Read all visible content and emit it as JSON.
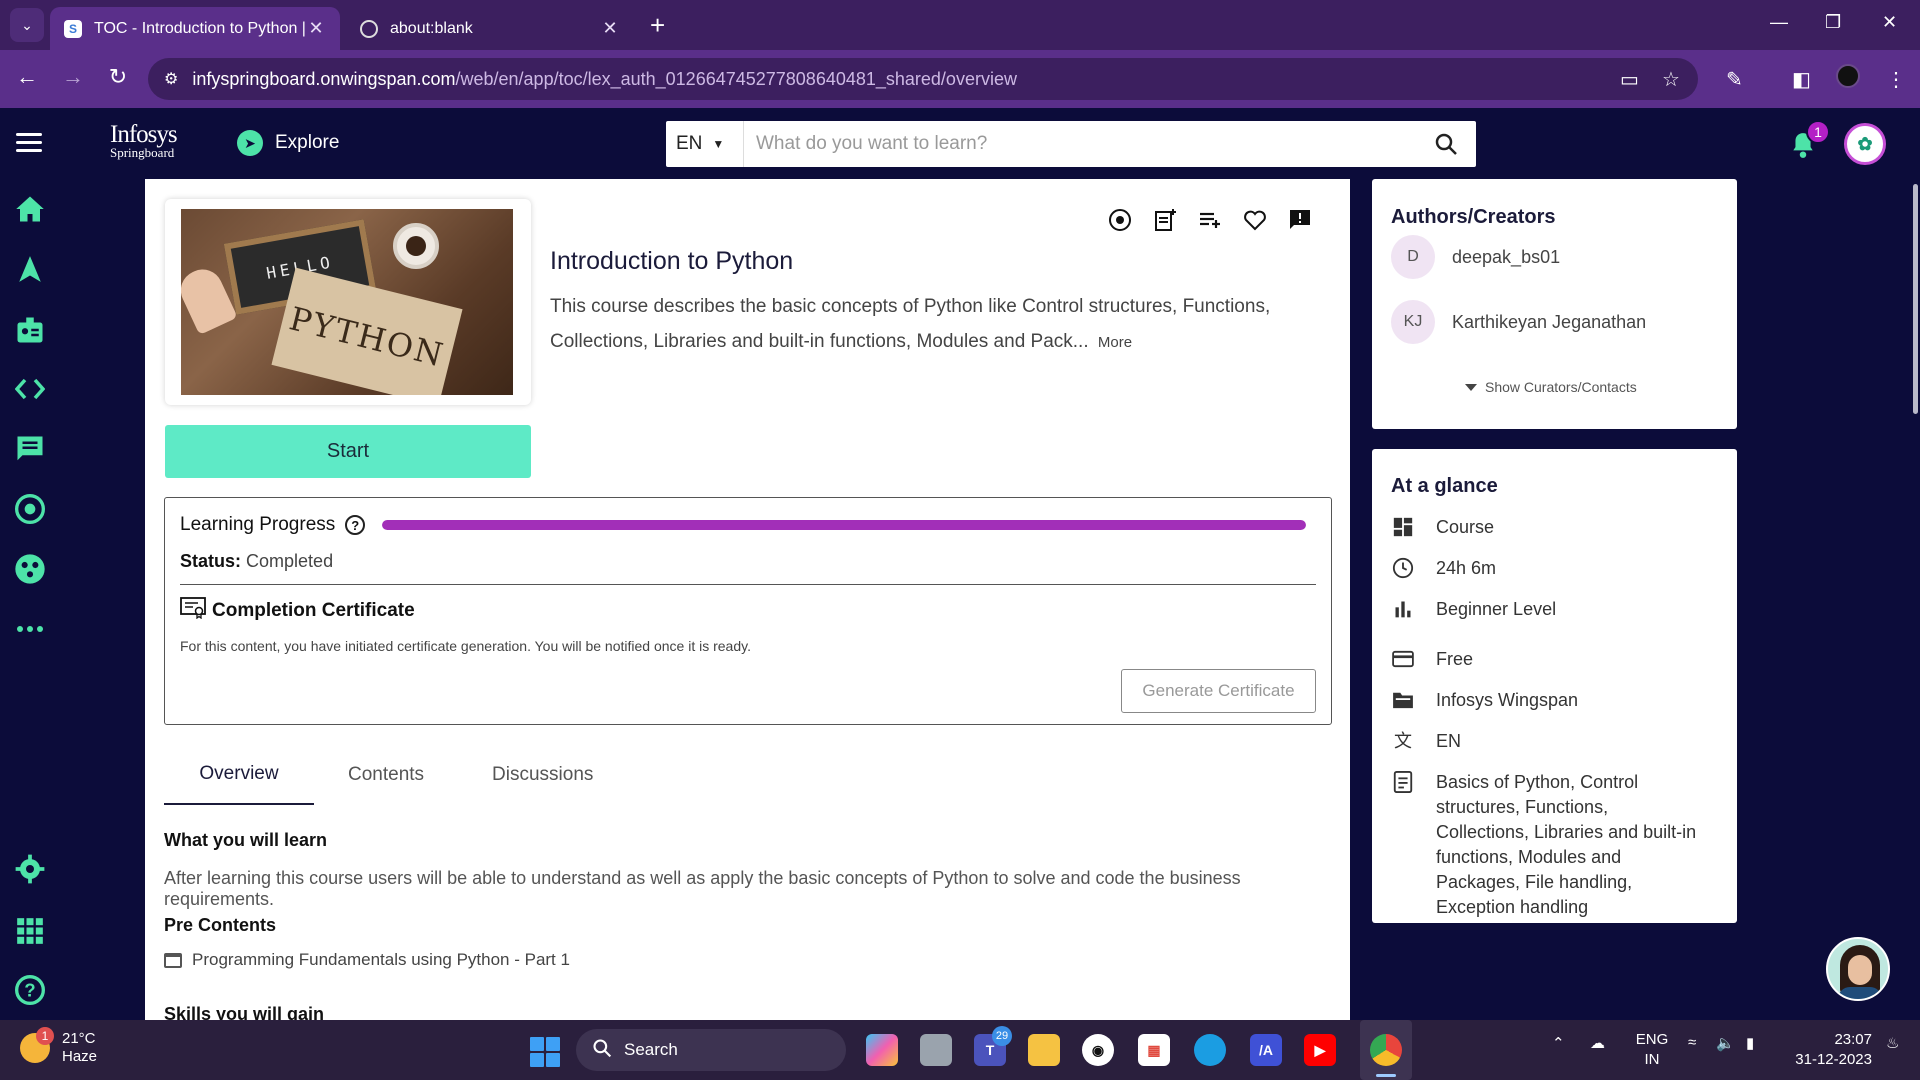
{
  "browser": {
    "tabs": [
      {
        "title": "TOC - Introduction to Python | I",
        "active": true
      },
      {
        "title": "about:blank",
        "active": false
      }
    ],
    "url_host": "infyspringboard.onwingspan.com",
    "url_path": "/web/en/app/toc/lex_auth_012664745277808640481_shared/overview"
  },
  "header": {
    "logo_line1": "Infosys",
    "logo_line2": "Springboard",
    "explore_label": "Explore",
    "language": "EN",
    "search_placeholder": "What do you want to learn?",
    "notification_count": "1"
  },
  "course": {
    "title": "Introduction to Python",
    "description": "This course describes the basic concepts of Python like Control structures, Functions, Collections, Libraries and built-in functions, Modules and Pack...",
    "more_label": "More",
    "start_label": "Start",
    "thumbnail_text_1": "HELLO",
    "thumbnail_text_2": "PYTHON"
  },
  "progress": {
    "title": "Learning Progress",
    "percent": 100,
    "status_label": "Status:",
    "status_value": "Completed",
    "cert_title": "Completion Certificate",
    "cert_note": "For this content, you have initiated certificate generation. You will be notified once it is ready.",
    "generate_label": "Generate Certificate"
  },
  "tabs": [
    {
      "label": "Overview",
      "active": true
    },
    {
      "label": "Contents",
      "active": false
    },
    {
      "label": "Discussions",
      "active": false
    }
  ],
  "overview": {
    "learn_heading": "What you will learn",
    "learn_text": "After learning this course users will be able to understand as well as apply the basic concepts of Python to solve and code the business requirements.",
    "pre_heading": "Pre Contents",
    "pre_item": "Programming Fundamentals using Python - Part 1",
    "skills_heading": "Skills you will gain"
  },
  "authors": {
    "heading": "Authors/Creators",
    "list": [
      {
        "initials": "D",
        "name": "deepak_bs01"
      },
      {
        "initials": "KJ",
        "name": "Karthikeyan Jeganathan"
      }
    ],
    "show_curators": "Show Curators/Contacts"
  },
  "glance": {
    "heading": "At a glance",
    "rows": [
      {
        "icon": "dashboard-icon",
        "text": "Course"
      },
      {
        "icon": "clock-icon",
        "text": "24h 6m"
      },
      {
        "icon": "bar-chart-icon",
        "text": "Beginner Level"
      },
      {
        "icon": "credit-card-icon",
        "text": "Free"
      },
      {
        "icon": "folder-icon",
        "text": "Infosys Wingspan"
      },
      {
        "icon": "translate-icon",
        "text": "EN"
      },
      {
        "icon": "description-icon",
        "text": "Basics of Python, Control structures, Functions, Collections, Libraries and built-in functions, Modules and Packages, File handling, Exception handling"
      }
    ]
  },
  "taskbar": {
    "weather_temp": "21°C",
    "weather_desc": "Haze",
    "weather_badge": "1",
    "search_label": "Search",
    "teams_badge": "29",
    "lang_line1": "ENG",
    "lang_line2": "IN",
    "time": "23:07",
    "date": "31-12-2023"
  },
  "colors": {
    "brand_dark": "#0c0c3a",
    "accent_green": "#5eeac6",
    "progress_purple": "#a22fb8",
    "browser_purple": "#5a2f8a"
  }
}
